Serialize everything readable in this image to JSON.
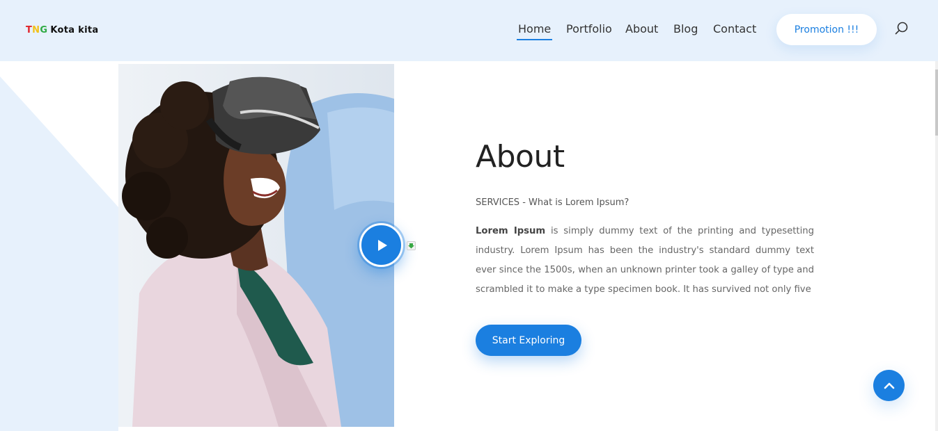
{
  "brand": {
    "t": "T",
    "n": "N",
    "g": "G",
    "rest": "Kota kita"
  },
  "nav": {
    "items": [
      {
        "label": "Home",
        "active": true
      },
      {
        "label": "Portfolio"
      },
      {
        "label": "About"
      },
      {
        "label": "Blog"
      },
      {
        "label": "Contact"
      }
    ],
    "promotion_label": "Promotion !!!"
  },
  "about": {
    "title": "About",
    "subtitle": "SERVICES - What is Lorem Ipsum?",
    "body_bold": "Lorem Ipsum",
    "body_rest": " is simply dummy text of the printing and typesetting industry. Lorem Ipsum has been the industry's standard dummy text ever since the 1500s, when an unknown printer took a galley of type and scrambled it to make a type specimen book. It has survived not only five",
    "cta_label": "Start Exploring"
  },
  "colors": {
    "accent": "#1b7fe0",
    "header_bg": "#e7f1fc"
  },
  "icons": {
    "search": "search-icon",
    "play": "play-icon",
    "back_to_top": "chevron-up-icon"
  }
}
